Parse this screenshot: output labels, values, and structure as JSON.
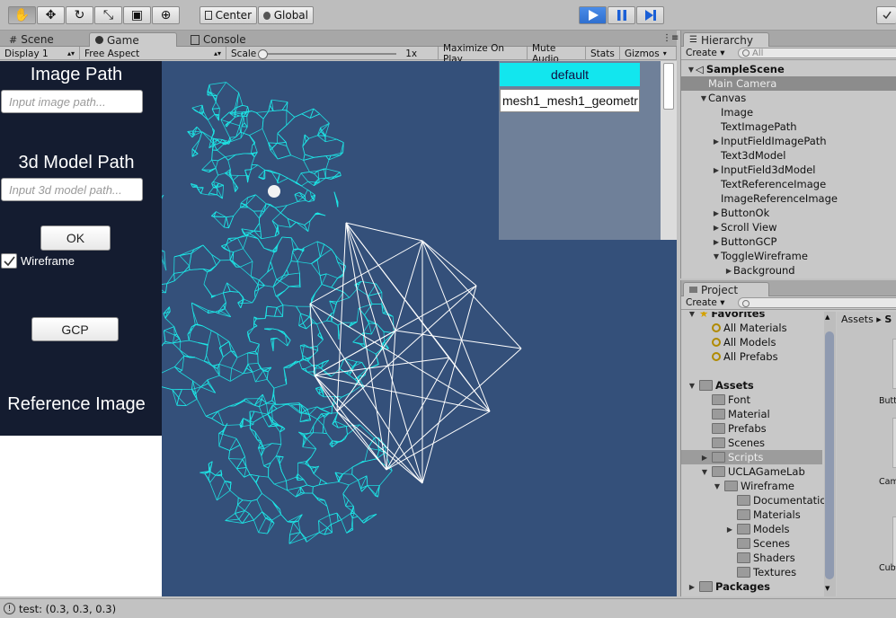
{
  "toolbar": {
    "tools": [
      "hand-tool-icon",
      "move-tool-icon",
      "rotate-tool-icon",
      "scale-tool-icon",
      "rect-tool-icon",
      "transform-tool-icon"
    ],
    "pivot": "Center",
    "space": "Global"
  },
  "tabs": {
    "scene": "Scene",
    "game": "Game",
    "console": "Console"
  },
  "gamebar": {
    "display": "Display 1",
    "aspect": "Free Aspect",
    "scale_label": "Scale",
    "scale_value": "1x",
    "maximize": "Maximize On Play",
    "mute": "Mute Audio",
    "stats": "Stats",
    "gizmos": "Gizmos"
  },
  "game": {
    "image_path_label": "Image Path",
    "image_path_placeholder": "Input image path...",
    "model_path_label": "3d Model Path",
    "model_path_placeholder": "Input 3d model path...",
    "ok_button": "OK",
    "wireframe_toggle": "Wireframe",
    "wireframe_checked": true,
    "gcp_button": "GCP",
    "reference_label": "Reference Image",
    "scroll_items": [
      "default",
      "mesh1_mesh1_geometr"
    ],
    "mesh_color": "#1ee6e6",
    "view_bg": "#34507a"
  },
  "hierarchy": {
    "tab": "Hierarchy",
    "create": "Create",
    "search_placeholder": "All",
    "items": [
      {
        "label": "SampleScene",
        "indent": 0,
        "arrow": "down",
        "bold": true,
        "icon": "unity-icon"
      },
      {
        "label": "Main Camera",
        "indent": 1,
        "arrow": "",
        "selected": true
      },
      {
        "label": "Canvas",
        "indent": 1,
        "arrow": "down"
      },
      {
        "label": "Image",
        "indent": 2,
        "arrow": ""
      },
      {
        "label": "TextImagePath",
        "indent": 2,
        "arrow": ""
      },
      {
        "label": "InputFieldImagePath",
        "indent": 2,
        "arrow": "right"
      },
      {
        "label": "Text3dModel",
        "indent": 2,
        "arrow": ""
      },
      {
        "label": "InputField3dModel",
        "indent": 2,
        "arrow": "right"
      },
      {
        "label": "TextReferenceImage",
        "indent": 2,
        "arrow": ""
      },
      {
        "label": "ImageReferenceImage",
        "indent": 2,
        "arrow": ""
      },
      {
        "label": "ButtonOk",
        "indent": 2,
        "arrow": "right"
      },
      {
        "label": "Scroll View",
        "indent": 2,
        "arrow": "right"
      },
      {
        "label": "ButtonGCP",
        "indent": 2,
        "arrow": "right"
      },
      {
        "label": "ToggleWireframe",
        "indent": 2,
        "arrow": "down"
      },
      {
        "label": "Background",
        "indent": 3,
        "arrow": "right"
      }
    ]
  },
  "project": {
    "tab": "Project",
    "create": "Create",
    "breadcrumb": "Assets",
    "breadcrumb_next": "S",
    "thumb_labels": [
      "Butt",
      "Cam",
      "Cub"
    ],
    "tree": [
      {
        "label": "Favorites",
        "indent": 0,
        "arrow": "down",
        "bold": true,
        "icon": "star"
      },
      {
        "label": "All Materials",
        "indent": 1,
        "icon": "search"
      },
      {
        "label": "All Models",
        "indent": 1,
        "icon": "search"
      },
      {
        "label": "All Prefabs",
        "indent": 1,
        "icon": "search"
      },
      {
        "label": "",
        "indent": 0,
        "spacer": true
      },
      {
        "label": "Assets",
        "indent": 0,
        "arrow": "down",
        "bold": true,
        "icon": "folder"
      },
      {
        "label": "Font",
        "indent": 1,
        "icon": "folder"
      },
      {
        "label": "Material",
        "indent": 1,
        "icon": "folder"
      },
      {
        "label": "Prefabs",
        "indent": 1,
        "icon": "folder"
      },
      {
        "label": "Scenes",
        "indent": 1,
        "icon": "folder"
      },
      {
        "label": "Scripts",
        "indent": 1,
        "icon": "folder",
        "arrow": "right",
        "selected": true
      },
      {
        "label": "UCLAGameLab",
        "indent": 1,
        "icon": "folder",
        "arrow": "down"
      },
      {
        "label": "Wireframe",
        "indent": 2,
        "icon": "folder",
        "arrow": "down"
      },
      {
        "label": "Documentation",
        "indent": 3,
        "icon": "folder"
      },
      {
        "label": "Materials",
        "indent": 3,
        "icon": "folder"
      },
      {
        "label": "Models",
        "indent": 3,
        "icon": "folder",
        "arrow": "right"
      },
      {
        "label": "Scenes",
        "indent": 3,
        "icon": "folder"
      },
      {
        "label": "Shaders",
        "indent": 3,
        "icon": "folder"
      },
      {
        "label": "Textures",
        "indent": 3,
        "icon": "folder"
      },
      {
        "label": "Packages",
        "indent": 0,
        "icon": "folder",
        "arrow": "right",
        "bold": true
      }
    ]
  },
  "status": {
    "text": "test: (0.3, 0.3, 0.3)"
  }
}
